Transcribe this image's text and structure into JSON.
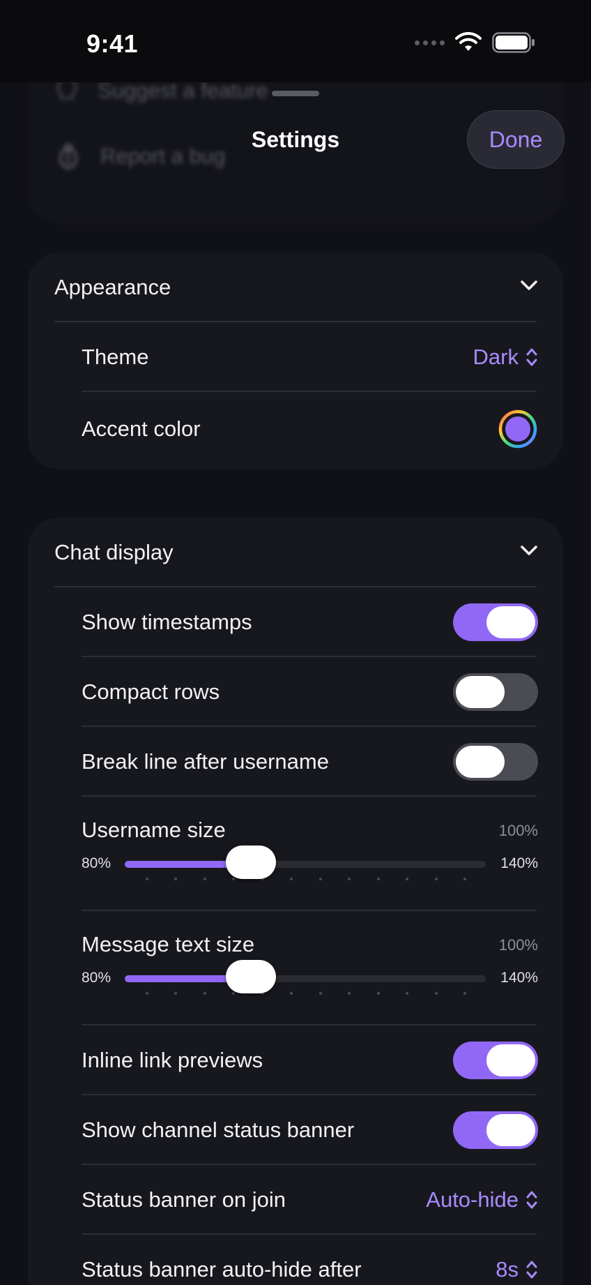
{
  "status_bar": {
    "time": "9:41"
  },
  "sheet": {
    "title": "Settings",
    "done_label": "Done"
  },
  "background_card": {
    "items": [
      "Suggest a feature",
      "Report a bug"
    ]
  },
  "appearance": {
    "title": "Appearance",
    "theme_label": "Theme",
    "theme_value": "Dark",
    "accent_label": "Accent color",
    "accent_color": "#9168f5"
  },
  "chat_display": {
    "title": "Chat display",
    "show_timestamps": {
      "label": "Show timestamps",
      "on": true
    },
    "compact_rows": {
      "label": "Compact rows",
      "on": false
    },
    "break_line": {
      "label": "Break line after username",
      "on": false
    },
    "username_size": {
      "label": "Username size",
      "value": "100%",
      "min": "80%",
      "max": "140%",
      "fraction": 0.33
    },
    "message_text_size": {
      "label": "Message text size",
      "value": "100%",
      "min": "80%",
      "max": "140%",
      "fraction": 0.33
    },
    "inline_link_previews": {
      "label": "Inline link previews",
      "on": true
    },
    "show_channel_status_banner": {
      "label": "Show channel status banner",
      "on": true
    },
    "status_banner_on_join": {
      "label": "Status banner on join",
      "value": "Auto-hide"
    },
    "status_banner_auto_hide": {
      "label": "Status banner auto-hide after",
      "value": "8s"
    }
  },
  "colors": {
    "accent": "#a98bff",
    "toggle_on": "#9168f5",
    "background": "#101116",
    "card": "#17181e"
  }
}
